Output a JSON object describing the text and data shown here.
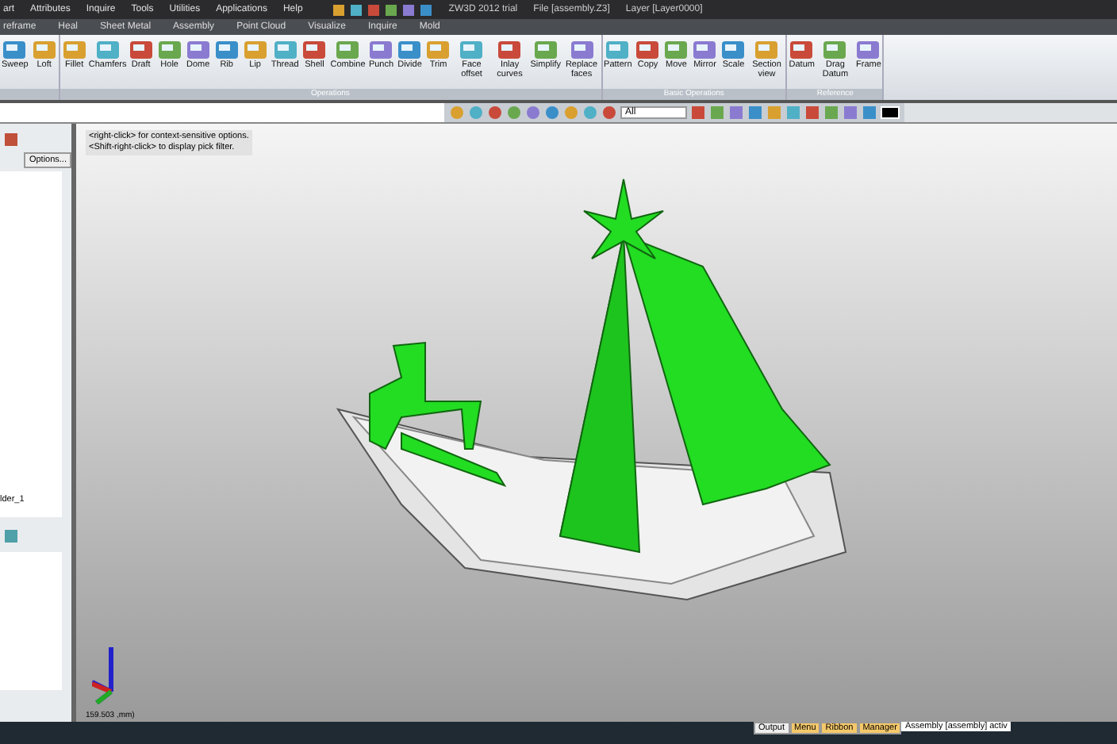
{
  "window": {
    "title": "ZW3D 2012 trial",
    "file": "File [assembly.Z3]",
    "layer": "Layer [Layer0000]"
  },
  "menu": [
    "art",
    "Attributes",
    "Inquire",
    "Tools",
    "Utilities",
    "Applications",
    "Help"
  ],
  "tabs": [
    {
      "label": "reframe",
      "selected": false
    },
    {
      "label": "Heal",
      "selected": false
    },
    {
      "label": "Sheet Metal",
      "selected": false
    },
    {
      "label": "Assembly",
      "selected": false
    },
    {
      "label": "Point Cloud",
      "selected": false
    },
    {
      "label": "Visualize",
      "selected": false
    },
    {
      "label": "Inquire",
      "selected": false
    },
    {
      "label": "Mold",
      "selected": false
    }
  ],
  "ribbon_groups": [
    {
      "tools": [
        "Sweep",
        "Loft"
      ]
    },
    {
      "name": "Operations",
      "tools": [
        "Fillet",
        "Chamfers",
        "Draft",
        "Hole",
        "Dome",
        "Rib",
        "Lip",
        "Thread",
        "Shell",
        "Combine",
        "Punch",
        "Divide",
        "Trim",
        "Face offset",
        "Inlay curves",
        "Simplify",
        "Replace faces"
      ]
    },
    {
      "name": "Basic Operations",
      "tools": [
        "Pattern",
        "Copy",
        "Move",
        "Mirror",
        "Scale",
        "Section view"
      ]
    },
    {
      "name": "Reference",
      "tools": [
        "Datum",
        "Drag Datum",
        "Frame"
      ]
    }
  ],
  "filter": {
    "value": "All"
  },
  "left_panel": {
    "options_button": "Options...",
    "tree_item": "lder_1"
  },
  "hints": [
    "<right-click> for context-sensitive options.",
    "<Shift-right-click> to display pick filter."
  ],
  "coordinates": "159.503 ,mm)",
  "status_bar": {
    "tabs": [
      {
        "label": "Output",
        "selected": false
      },
      {
        "label": "Menu",
        "selected": true
      },
      {
        "label": "Ribbon",
        "selected": true
      },
      {
        "label": "Manager",
        "selected": true
      }
    ],
    "message": "Assembly [assembly] activ"
  }
}
